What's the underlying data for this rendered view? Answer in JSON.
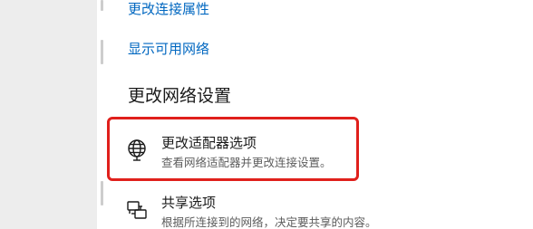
{
  "links": {
    "change_connection_properties": "更改连接属性",
    "show_available_networks": "显示可用网络"
  },
  "section": {
    "title": "更改网络设置"
  },
  "options": [
    {
      "title": "更改适配器选项",
      "description": "查看网络适配器并更改连接设置。",
      "icon": "globe-monitor-icon"
    },
    {
      "title": "共享选项",
      "description": "根据所连接到的网络，决定要共享的内容。",
      "icon": "sharing-icon"
    }
  ],
  "colors": {
    "link": "#0067c0",
    "highlight": "#e0201c",
    "nav_background": "#ededed"
  }
}
